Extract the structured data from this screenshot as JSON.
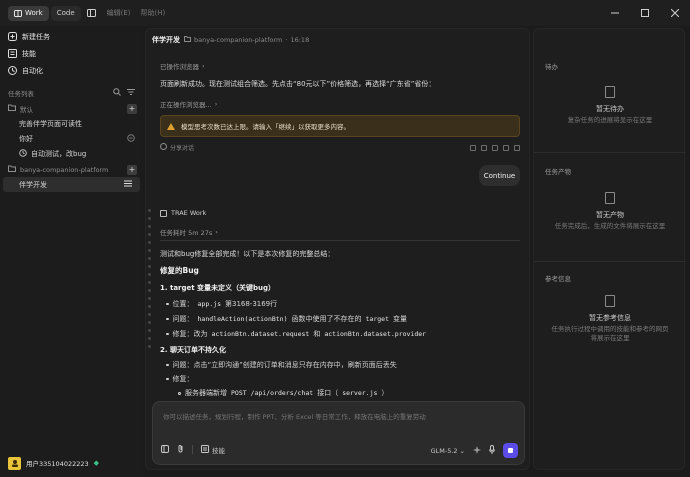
{
  "titlebar": {
    "mode_work": "Work",
    "mode_code": "Code",
    "menu": [
      "编辑(E)",
      "帮助(H)"
    ]
  },
  "sidebar": {
    "nav": [
      {
        "label": "新建任务",
        "icon": "new-task-icon"
      },
      {
        "label": "技能",
        "icon": "skills-icon"
      },
      {
        "label": "自动化",
        "icon": "automation-icon"
      }
    ],
    "task_list_label": "任务列表",
    "groups": [
      {
        "name": "默认",
        "tasks": [
          {
            "label": "完善伴学页面可读性"
          },
          {
            "label": "你好"
          },
          {
            "label": "自动测试，改bug"
          }
        ]
      },
      {
        "name": "banya-companion-platform",
        "tasks": [
          {
            "label": "伴学开发",
            "active": true
          }
        ]
      }
    ],
    "user": {
      "name": "用户335104022223"
    }
  },
  "main": {
    "title": "伴学开发",
    "project": "banya-companion-platform",
    "time": "16:18",
    "tool_line_1": "已操作浏览器",
    "msg_1": "页面刷新成功。现在测试组合筛选。先点击“80元以下”价格筛选，再选择“广东省”省份：",
    "tool_line_2": "正在操作浏览器...",
    "warning": "模型思考次数已达上限。请输入「继续」以获取更多内容。",
    "share_label": "分享对话",
    "user_msg": "Continue",
    "agent_name": "TRAE Work",
    "task_time": "任务耗时 5m 27s",
    "result_intro": "测试和bug修复全部完成！以下是本次修复的完整总结：",
    "fixed_heading": "修复的Bug",
    "bug1_title": "1. target 变量未定义（关键bug）",
    "bug1_pos_label": "位置：",
    "bug1_pos_code": "app.js",
    "bug1_pos_rest": "第3168-3169行",
    "bug1_issue_label": "问题：",
    "bug1_issue_code1": "handleAction(actionBtn)",
    "bug1_issue_mid": "函数中使用了不存在的",
    "bug1_issue_code2": "target",
    "bug1_issue_end": "变量",
    "bug1_fix_label": "修复：改为",
    "bug1_fix_code1": "actionBtn.dataset.request",
    "bug1_fix_mid": "和",
    "bug1_fix_code2": "actionBtn.dataset.provider",
    "bug2_title": "2. 聊天订单不持久化",
    "bug2_issue": "问题：点击“立即沟通”创建的订单和消息只存在内存中，刷新页面后丢失",
    "bug2_fix_label": "修复：",
    "bug2_sub": "服务器端新增",
    "bug2_sub_code": "POST /api/orders/chat",
    "bug2_sub_rest": "接口（",
    "bug2_sub_code2": "server.js",
    "bug2_sub_end": "）"
  },
  "composer": {
    "placeholder": "你可以描述任务，规划行程，制作 PPT、分析 Excel 等日常工作，释放在电脑上的重复劳动",
    "skills_label": "技能",
    "model": "GLM-5.2"
  },
  "right_panel": {
    "todo_title": "待办",
    "todo_empty": "暂无待办",
    "todo_desc": "复杂任务的进展将显示在这里",
    "output_title": "任务产物",
    "output_empty": "暂无产物",
    "output_desc": "任务完成后，生成的文件将展示在这里",
    "ref_title": "参考信息",
    "ref_empty": "暂无参考信息",
    "ref_desc": "任务执行过程中调用的技能和参考的网页将展示在这里"
  }
}
